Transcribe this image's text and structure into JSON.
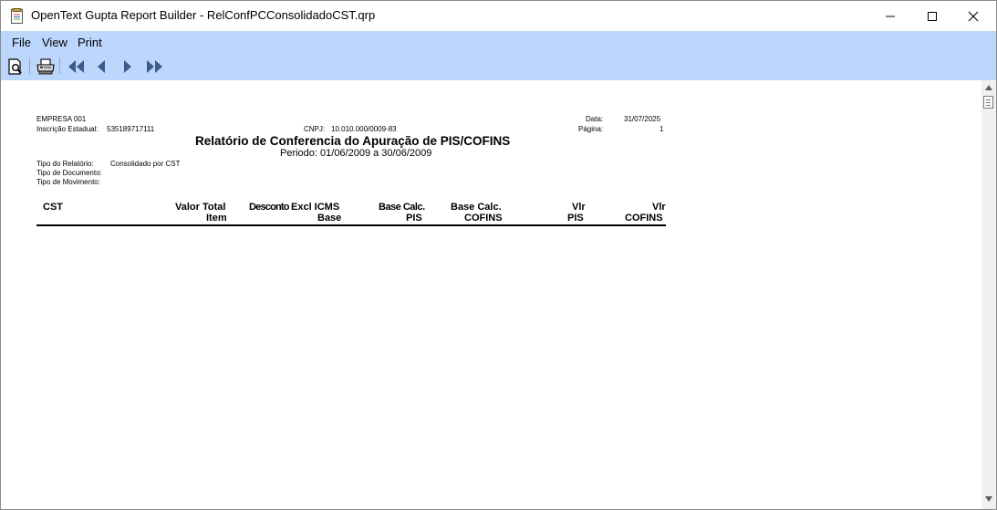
{
  "window": {
    "title": "OpenText Gupta Report Builder - RelConfPCConsolidadoCST.qrp",
    "icons": [
      "report-app-icon",
      "minimize-icon",
      "maximize-icon",
      "close-icon"
    ]
  },
  "menu": {
    "file": "File",
    "view": "View",
    "print": "Print"
  },
  "toolbar": {
    "icons": [
      "print-preview-icon",
      "printer-icon",
      "first-page-icon",
      "previous-page-icon",
      "next-page-icon",
      "last-page-icon"
    ]
  },
  "report": {
    "company": "EMPRESA 001",
    "ie_label": "Inscrição Estadual:",
    "ie_value": "535189717111",
    "cnpj_label": "CNPJ:",
    "cnpj_value": "10.010.000/0009-83",
    "date_label": "Data:",
    "date_value": "31/07/2025",
    "page_label": "Página:",
    "page_value": "1",
    "title": "Relatório de Conferencia do Apuração de PIS/COFINS",
    "period": "Periodo: 01/06/2009 a 30/06/2009",
    "tipo_relatorio_label": "Tipo do Relatório:",
    "tipo_relatorio_value": "Consolidado por CST",
    "tipo_documento_label": "Tipo de Documento:",
    "tipo_movimento_label": "Tipo de Movimento:",
    "columns": {
      "cst": "CST",
      "valor_total": "Valor Total",
      "item": "Item",
      "desconto": "Desconto",
      "excl_icms": "Excl ICMS",
      "base": "Base",
      "base_calc_pis_1": "Base Calc.",
      "base_calc_pis_2": "PIS",
      "base_calc_cofins_1": "Base Calc.",
      "base_calc_cofins_2": "COFINS",
      "vlr_pis_1": "Vlr",
      "vlr_pis_2": "PIS",
      "vlr_cofins_1": "Vlr",
      "vlr_cofins_2": "COFINS"
    }
  },
  "colors": {
    "menubar_bg": "#bcd7fb",
    "toolbar_icon": "#3b5b8c",
    "titlebar_bg": "#ffffff"
  }
}
